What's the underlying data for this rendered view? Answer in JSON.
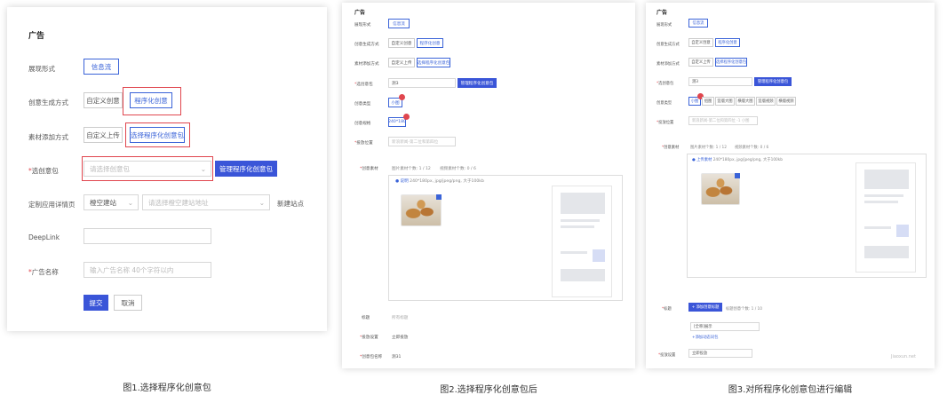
{
  "fig1": {
    "title": "广告",
    "display_label": "展现形式",
    "display_value": "信息流",
    "creative_label": "创意生成方式",
    "creative_opt1": "自定义创意",
    "creative_opt2": "程序化创意",
    "material_label": "素材添加方式",
    "material_opt1": "自定义上传",
    "material_opt2": "选择程序化创意包",
    "pkg_label": "选创意包",
    "pkg_placeholder": "请选择创意包",
    "pkg_manage": "管理程序化创意包",
    "landing_label": "定制应用详情页",
    "landing_select": "橙空建站",
    "landing_placeholder": "请选择橙空建站地址",
    "new_site": "新建站点",
    "deeplink_label": "DeepLink",
    "adname_label": "广告名称",
    "adname_placeholder": "输入广告名称 40个字符以内",
    "submit": "提交",
    "cancel": "取消",
    "caption": "图1.选择程序化创意包"
  },
  "fig2": {
    "title": "广告",
    "display_label": "展现形式",
    "display_value": "信息流",
    "creative_label": "创意生成方式",
    "creative_opt1": "自定义创意",
    "creative_opt2": "程序化创意",
    "material_label": "素材添加方式",
    "material_opt1": "自定义上传",
    "material_opt2": "选择程序化创意包",
    "pkg_label": "选创意包",
    "pkg_value": "测3",
    "pkg_manage": "管理程序化创意包",
    "type_label": "创意类型",
    "type_value": "小图",
    "spec_label": "创意规格",
    "spec_value": "240*180",
    "pos_label": "投放位置",
    "pos_value": "新浪新闻-第二位和第四位",
    "material_section_label": "创意素材",
    "image_count": "图片素材个数: 1 / 12",
    "video_count": "视频素材个数: 0 / 6",
    "tip_prefix": "说明",
    "tip_text": "240*180px, jpg/jpeg/png, 大于100kb",
    "title_label": "标题",
    "title_placeholder": "所有标题",
    "monitor_label": "投放设置",
    "monitor_value": "立即投放",
    "pkg_name_label": "创意包名称",
    "pkg_name_value": "测31",
    "caption": "图2.选择程序化创意包后"
  },
  "fig3": {
    "title": "广告",
    "display_label": "展现形式",
    "display_value": "信息流",
    "creative_label": "创意生成方式",
    "creative_opt1": "自定义创意",
    "creative_opt2": "程序化创意",
    "material_label": "素材添加方式",
    "material_opt1": "自定义上传",
    "material_opt2": "选择程序化创意包",
    "pkg_label": "选创意包",
    "pkg_value": "测3",
    "pkg_manage": "管理程序化创意包",
    "type_label": "创意类型",
    "type_tabs": [
      "小图",
      "组图",
      "竖版大图",
      "横版大图",
      "竖版视频",
      "横版视频"
    ],
    "pos_label": "投放位置",
    "pos_value": "新浪新闻-第二位和第四位 -1 小图",
    "material_section_label": "创意素材",
    "image_count": "图片素材个数: 1 / 12",
    "video_count": "视频素材个数: 0 / 6",
    "tip_prefix": "上传素材",
    "tip_text": "240*180px, jpg/jpeg/png, 大于100kb",
    "title_label": "标题",
    "add_title": "+ 添加创意标题",
    "title_count": "标题创意个数: 1 / 10",
    "title_input": "[全称]展示",
    "add_word": "+添加动态词包",
    "monitor_label": "投放设置",
    "monitor_value": "立即投放",
    "caption": "图3.对所程序化创意包进行编辑"
  },
  "watermark": "Jiaoxun.net"
}
